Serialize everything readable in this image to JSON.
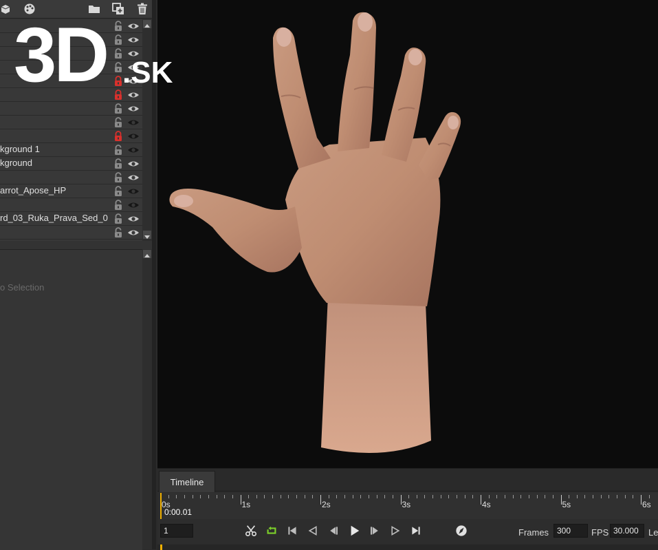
{
  "toolbar": {
    "icons": [
      "cube-icon",
      "palette-icon",
      "folder-icon",
      "new-layer-icon",
      "trash-icon"
    ]
  },
  "layers": [
    {
      "name": "",
      "locked": false
    },
    {
      "name": "",
      "locked": false
    },
    {
      "name": "",
      "locked": false
    },
    {
      "name": "",
      "locked": false
    },
    {
      "name": "",
      "locked": true
    },
    {
      "name": "",
      "locked": true
    },
    {
      "name": "",
      "locked": false
    },
    {
      "name": "",
      "locked": false
    },
    {
      "name": "",
      "locked": true
    },
    {
      "name": "kground 1",
      "locked": false
    },
    {
      "name": "kground",
      "locked": false
    },
    {
      "name": "",
      "locked": false
    },
    {
      "name": "arrot_Apose_HP",
      "locked": false
    },
    {
      "name": "rd_03_Ruka_Prava_Sed_0",
      "locked": false
    },
    {
      "name": "",
      "locked": false
    }
  ],
  "properties": {
    "empty_text": "o Selection"
  },
  "logo": {
    "main": "3D",
    "suffix": ".SK"
  },
  "timeline": {
    "tab_label": "Timeline",
    "ruler_labels": [
      "0s",
      "1s",
      "2s",
      "3s",
      "4s",
      "5s",
      "6s"
    ],
    "current_time": "0:00.01",
    "frame_field": "1",
    "frames_label": "Frames",
    "frames_value": "300",
    "fps_label": "FPS",
    "fps_value": "30.000",
    "length_label_partial": "Le"
  },
  "colors": {
    "lock_red": "#d9302c",
    "playhead": "#f0b000",
    "loop_green": "#7ccf2a"
  }
}
